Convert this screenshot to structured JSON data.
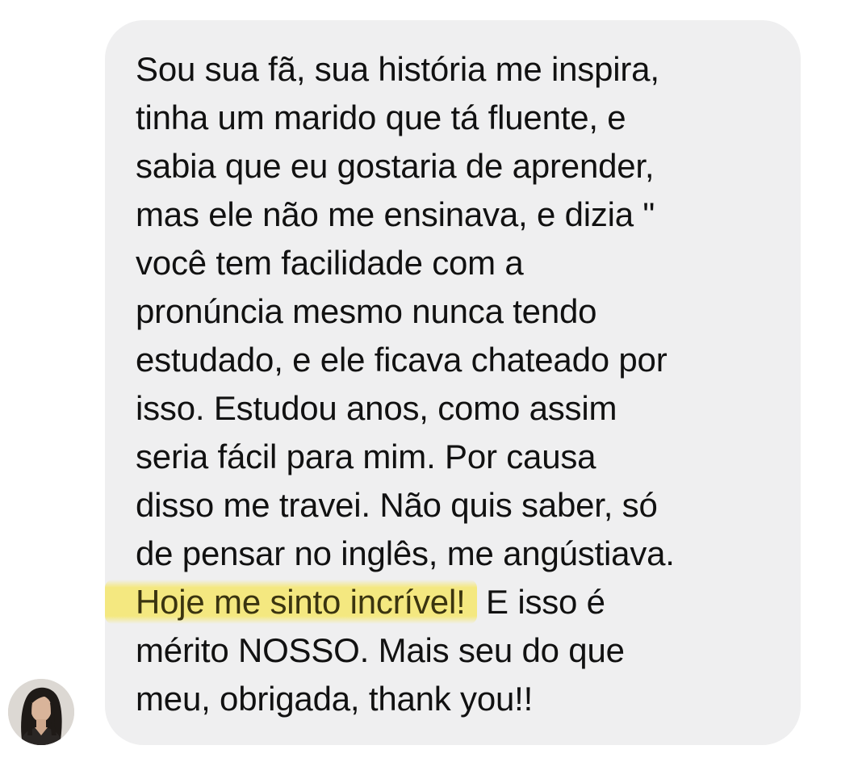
{
  "message": {
    "lines": [
      "Sou sua fã, sua história me inspira,",
      "tinha um marido que tá fluente, e",
      "sabia que eu gostaria de aprender,",
      "mas ele não me ensinava, e dizia \"",
      "você tem facilidade com a",
      "pronúncia mesmo nunca tendo",
      "estudado, e ele ficava chateado por",
      "isso. Estudou anos, como assim",
      "seria fácil para mim. Por causa",
      "disso me travei. Não quis saber, só",
      "de pensar no inglês, me angústiava."
    ],
    "highlighted": "Hoje me sinto incrível!",
    "after_highlight": " E isso é",
    "closing_lines": [
      "mérito NOSSO. Mais seu do que",
      "meu, obrigada, thank you!!"
    ],
    "highlight_color": "#f6e65a",
    "bubble_color": "#efeff0"
  },
  "sender": {
    "avatar_icon": "profile-photo-icon"
  }
}
